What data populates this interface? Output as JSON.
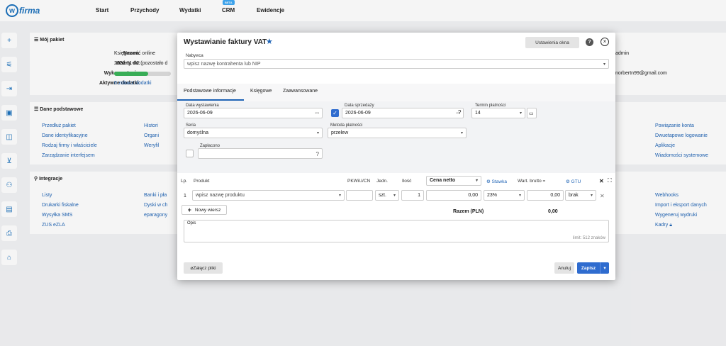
{
  "app": {
    "logo_letter": "w",
    "logo_text": "firma"
  },
  "nav": [
    "Start",
    "Przychody",
    "Wydatki",
    "CRM",
    "Ewidencje"
  ],
  "crm_badge": "BETA",
  "sidebar_icons": [
    "plus-icon",
    "sliders-icon",
    "login-icon",
    "clipboard-icon",
    "wallet-icon",
    "cart-icon",
    "add-user-icon",
    "calendar-icon",
    "printer-icon",
    "home-icon"
  ],
  "package": {
    "title": "Mój pakiet",
    "rows": [
      {
        "label": "Nazwa:",
        "value": "Księgowość online"
      },
      {
        "label": "Ważny do:",
        "value": "2026-11-02 (pozostało d"
      },
      {
        "label": "Wykorzystanie:",
        "value": ""
      },
      {
        "label": "Aktywne dodatki:",
        "value": "0 zobacz dodatki"
      }
    ],
    "usage_fraction": 0.6
  },
  "right_info": {
    "role": "admin",
    "email": "norbertn99@gmail.com"
  },
  "basic": {
    "title": "Dane podstawowe",
    "col1": [
      "Przedłuż pakiet",
      "Dane identyfikacyjne",
      "Rodzaj firmy i właściciele",
      "Zarządzanie interfejsem"
    ],
    "col2": [
      "Histori",
      "Organi",
      "Weryfil"
    ],
    "right": [
      "Powiązanie konta",
      "Dwuetapowe logowanie",
      "Aplikacje",
      "Wiadomości systemowe"
    ]
  },
  "integrations": {
    "title": "Integracje",
    "col1": [
      "Listy",
      "Drukarki fiskalne",
      "Wysyłka SMS",
      "ZUS eZLA"
    ],
    "col2": [
      "Banki i pła",
      "Dyski w ch",
      "eparagony"
    ],
    "right": [
      "Webhooks",
      "Import i eksport danych",
      "Wygeneruj wydruki",
      "Kadry"
    ]
  },
  "modal": {
    "title": "Wystawianie faktury VAT",
    "settings_button": "Ustawienia okna",
    "buyer_label": "Nabywca",
    "buyer_placeholder": "wpisz nazwę kontrahenta lub NIP",
    "tabs": [
      "Podstawowe informacje",
      "Księgowe",
      "Zaawansowane"
    ],
    "issue_date_label": "Data wystawienia",
    "issue_date": "2026-06-09",
    "sale_date_label": "Data sprzedaży",
    "sale_date": "2026-06-09",
    "due_label": "Termin płatności",
    "due_value": "14",
    "series_label": "Seria",
    "series_value": "domyślna",
    "payment_label": "Metoda płatności",
    "payment_value": "przelew",
    "paid_label": "Zapłacono",
    "table_headers": {
      "lp": "Lp.",
      "product": "Produkt",
      "pkwiu": "PKWiU/CN",
      "unit": "Jedn.",
      "qty": "Ilość",
      "price_type": "Cena netto",
      "rate": "Stawka",
      "gross": "Wart. brutto =",
      "gtu": "GTU"
    },
    "row": {
      "lp": "1",
      "product_placeholder": "wpisz nazwę produktu",
      "unit": "szt.",
      "qty": "1",
      "price": "0,00",
      "rate": "23%",
      "gross": "0,00",
      "gtu": "brak"
    },
    "new_row": "Nowy wiersz",
    "total_label": "Razem (PLN)",
    "total_value": "0,00",
    "notes_label": "Opis",
    "notes_limit": "limit: 512 znaków",
    "attach": "Załącz pliki",
    "cancel": "Anuluj",
    "save": "Zapisz"
  }
}
